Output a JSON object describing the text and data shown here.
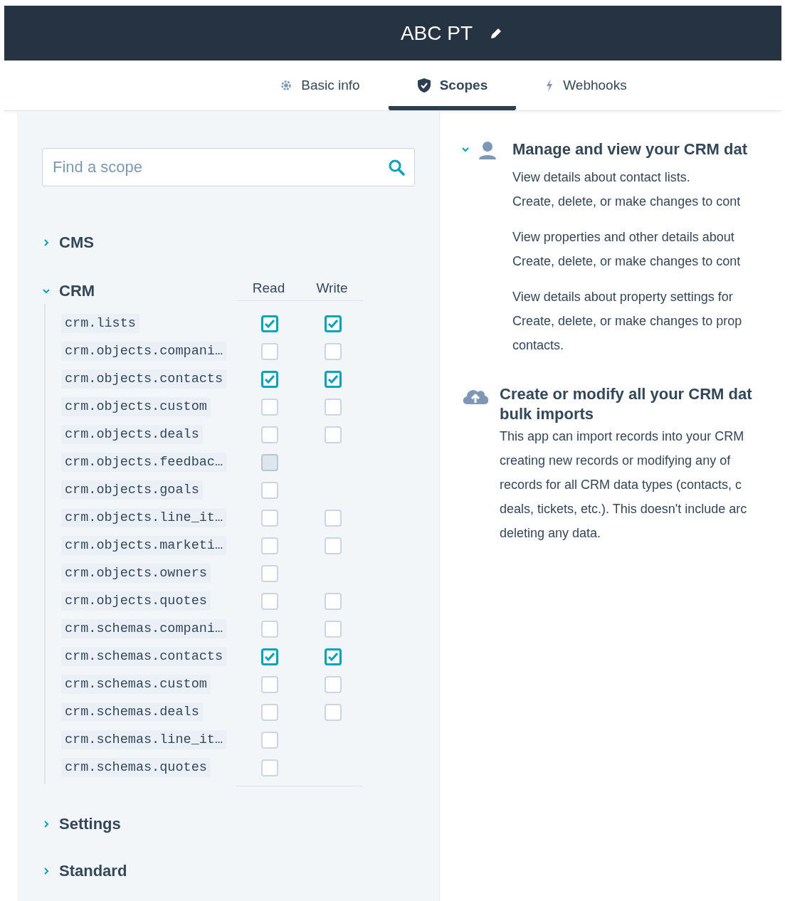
{
  "header": {
    "title": "ABC PT"
  },
  "tabs": [
    {
      "label": "Basic info",
      "selected": false
    },
    {
      "label": "Scopes",
      "selected": true
    },
    {
      "label": "Webhooks",
      "selected": false
    }
  ],
  "search": {
    "placeholder": "Find a scope"
  },
  "groups": [
    {
      "label": "CMS",
      "expanded": false
    },
    {
      "label": "CRM",
      "expanded": true,
      "columns": [
        "Read",
        "Write"
      ],
      "scopes": [
        {
          "name": "crm.lists",
          "read": {
            "checked": true,
            "disabled": false
          },
          "write": {
            "checked": true,
            "disabled": false
          }
        },
        {
          "name": "crm.objects.compani…",
          "read": {
            "checked": false,
            "disabled": false
          },
          "write": {
            "checked": false,
            "disabled": false
          }
        },
        {
          "name": "crm.objects.contacts",
          "read": {
            "checked": true,
            "disabled": false
          },
          "write": {
            "checked": true,
            "disabled": false
          }
        },
        {
          "name": "crm.objects.custom",
          "read": {
            "checked": false,
            "disabled": false
          },
          "write": {
            "checked": false,
            "disabled": false
          }
        },
        {
          "name": "crm.objects.deals",
          "read": {
            "checked": false,
            "disabled": false
          },
          "write": {
            "checked": false,
            "disabled": false
          }
        },
        {
          "name": "crm.objects.feedbac…",
          "read": {
            "checked": false,
            "disabled": true
          }
        },
        {
          "name": "crm.objects.goals",
          "read": {
            "checked": false,
            "disabled": false
          }
        },
        {
          "name": "crm.objects.line_it…",
          "read": {
            "checked": false,
            "disabled": false
          },
          "write": {
            "checked": false,
            "disabled": false
          }
        },
        {
          "name": "crm.objects.marketi…",
          "read": {
            "checked": false,
            "disabled": false
          },
          "write": {
            "checked": false,
            "disabled": false
          }
        },
        {
          "name": "crm.objects.owners",
          "read": {
            "checked": false,
            "disabled": false
          }
        },
        {
          "name": "crm.objects.quotes",
          "read": {
            "checked": false,
            "disabled": false
          },
          "write": {
            "checked": false,
            "disabled": false
          }
        },
        {
          "name": "crm.schemas.compani…",
          "read": {
            "checked": false,
            "disabled": false
          },
          "write": {
            "checked": false,
            "disabled": false
          }
        },
        {
          "name": "crm.schemas.contacts",
          "read": {
            "checked": true,
            "disabled": false
          },
          "write": {
            "checked": true,
            "disabled": false
          }
        },
        {
          "name": "crm.schemas.custom",
          "read": {
            "checked": false,
            "disabled": false
          },
          "write": {
            "checked": false,
            "disabled": false
          }
        },
        {
          "name": "crm.schemas.deals",
          "read": {
            "checked": false,
            "disabled": false
          },
          "write": {
            "checked": false,
            "disabled": false
          }
        },
        {
          "name": "crm.schemas.line_it…",
          "read": {
            "checked": false,
            "disabled": false
          }
        },
        {
          "name": "crm.schemas.quotes",
          "read": {
            "checked": false,
            "disabled": false
          }
        }
      ]
    },
    {
      "label": "Settings",
      "expanded": false
    },
    {
      "label": "Standard",
      "expanded": false
    }
  ],
  "details": [
    {
      "expanded": true,
      "title_lines": [
        "Manage and view your CRM dat"
      ],
      "paragraphs": [
        [
          "View details about contact lists.",
          "Create, delete, or make changes to cont"
        ],
        [
          "View properties and other details about",
          "Create, delete, or make changes to cont"
        ],
        [
          "View details about property settings for",
          "Create, delete, or make changes to prop",
          "contacts."
        ]
      ]
    },
    {
      "title_lines": [
        "Create or modify all your CRM dat",
        "bulk imports"
      ],
      "paragraphs": [
        [
          "This app can import records into your CRM",
          "creating new records or modifying any of",
          "records for all CRM data types (contacts, c",
          "deals, tickets, etc.). This doesn't include arc",
          "deleting any data."
        ]
      ]
    }
  ]
}
